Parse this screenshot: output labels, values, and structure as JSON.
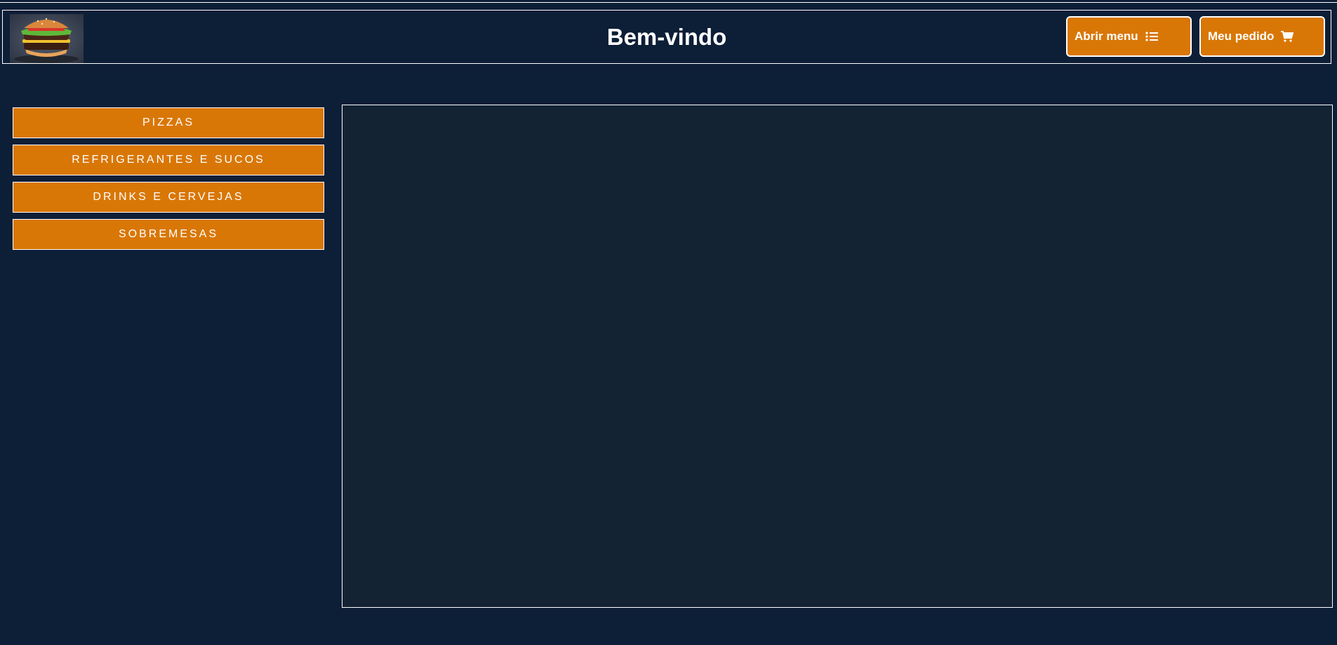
{
  "header": {
    "title": "Bem-vindo",
    "open_menu_label": "Abrir menu",
    "my_order_label": "Meu pedido",
    "logo_icon": "burger-logo",
    "menu_icon": "list-icon",
    "cart_icon": "cart-icon"
  },
  "sidebar": {
    "items": [
      {
        "label": "PIZZAS"
      },
      {
        "label": "REFRIGERANTES E SUCOS"
      },
      {
        "label": "DRINKS E CERVEJAS"
      },
      {
        "label": "SOBREMESAS"
      }
    ]
  },
  "colors": {
    "background": "#0d1e37",
    "panel": "#132334",
    "accent": "#d97706",
    "border": "#ffffff"
  }
}
